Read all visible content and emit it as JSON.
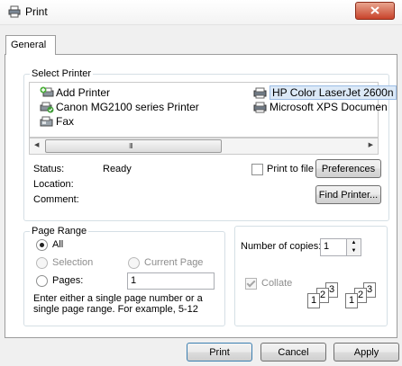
{
  "window": {
    "title": "Print"
  },
  "tabs": [
    {
      "label": "General"
    }
  ],
  "select_printer": {
    "legend": "Select Printer",
    "printers": [
      {
        "name": "Add Printer",
        "icon": "add-printer-icon"
      },
      {
        "name": "Canon MG2100 series Printer",
        "icon": "printer-default-icon"
      },
      {
        "name": "Fax",
        "icon": "fax-icon"
      },
      {
        "name": "HP Color LaserJet 2600n",
        "icon": "printer-icon",
        "selected": true
      },
      {
        "name": "Microsoft XPS Documen",
        "icon": "printer-icon"
      }
    ],
    "scrollbar_grip": "III",
    "status_label": "Status:",
    "status_value": "Ready",
    "location_label": "Location:",
    "comment_label": "Comment:",
    "print_to_file_label": "Print to file",
    "preferences_label": "Preferences",
    "find_printer_label": "Find Printer..."
  },
  "page_range": {
    "legend": "Page Range",
    "all_label": "All",
    "selection_label": "Selection",
    "current_page_label": "Current Page",
    "pages_label": "Pages:",
    "pages_value": "1",
    "hint": "Enter either a single page number or a single page range.  For example, 5-12",
    "selected": "All"
  },
  "copies": {
    "number_label": "Number of copies:",
    "number_value": "1",
    "collate_label": "Collate",
    "collate_checked": true,
    "collate_enabled": false,
    "collate_pages": [
      "1",
      "2",
      "3",
      "1",
      "2",
      "3"
    ]
  },
  "footer": {
    "print_label": "Print",
    "cancel_label": "Cancel",
    "apply_label": "Apply"
  },
  "colors": {
    "title_close": "#c8432b",
    "selected_bg": "#dce9f7",
    "disabled_text": "#8d8d8d"
  }
}
